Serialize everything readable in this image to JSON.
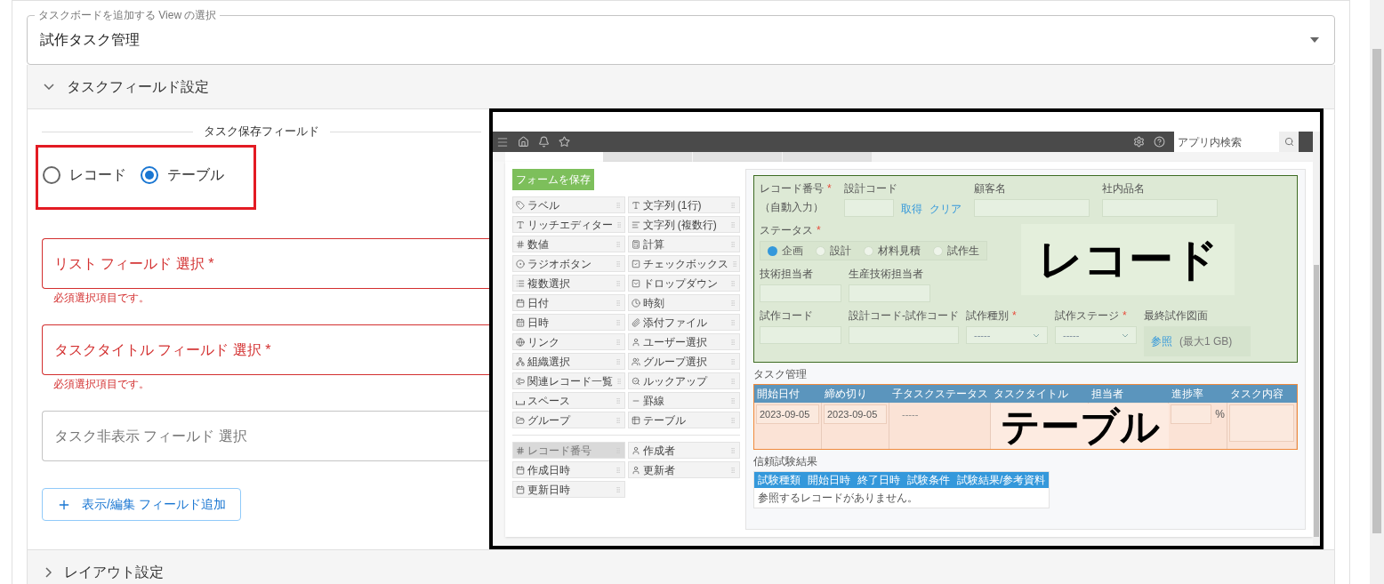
{
  "view_select": {
    "label": "タスクボードを追加する View の選択",
    "value": "試作タスク管理"
  },
  "task_field_settings": {
    "title": "タスクフィールド設定",
    "expanded": true,
    "storage": {
      "title": "タスク保存フィールド",
      "options": [
        {
          "label": "レコード",
          "selected": false
        },
        {
          "label": "テーブル",
          "selected": true
        }
      ]
    },
    "fields": [
      {
        "label": "リスト フィールド 選択 *",
        "error": true,
        "helper": "必須選択項目です。"
      },
      {
        "label": "タスクタイトル フィールド 選択 *",
        "error": true,
        "helper": "必須選択項目です。"
      },
      {
        "label": "タスク非表示 フィールド 選択",
        "error": false
      }
    ],
    "add_button": "表示/編集 フィールド追加"
  },
  "layout_settings": {
    "title": "レイアウト設定",
    "expanded": false
  },
  "screenshot": {
    "search": {
      "placeholder": "アプリ内検索"
    },
    "save_button": "フォームを保存",
    "palette": [
      "ラベル",
      "文字列 (1行)",
      "リッチエディター",
      "文字列 (複数行)",
      "数値",
      "計算",
      "ラジオボタン",
      "チェックボックス",
      "複数選択",
      "ドロップダウン",
      "日付",
      "時刻",
      "日時",
      "添付ファイル",
      "リンク",
      "ユーザー選択",
      "組織選択",
      "グループ選択",
      "関連レコード一覧",
      "ルックアップ",
      "スペース",
      "罫線",
      "グループ",
      "テーブル"
    ],
    "system_fields": [
      {
        "label": "レコード番号",
        "disabled": true
      },
      {
        "label": "作成者",
        "disabled": false
      },
      {
        "label": "作成日時",
        "disabled": false
      },
      {
        "label": "更新者",
        "disabled": false
      },
      {
        "label": "更新日時",
        "disabled": false
      }
    ],
    "record_area": {
      "label": "レコード",
      "row_1": [
        {
          "kind": "auto",
          "label": "レコード番号",
          "mark": "*",
          "note": "（自動入力）"
        },
        {
          "kind": "lookup",
          "label": "設計コード",
          "links": [
            "取得",
            "クリア"
          ]
        },
        {
          "kind": "wide",
          "label": "顧客名"
        },
        {
          "kind": "wide",
          "label": "社内品名"
        }
      ],
      "status": {
        "label": "ステータス",
        "mark": "*",
        "options": [
          {
            "label": "企画",
            "selected": true
          },
          {
            "label": "設計",
            "selected": false
          },
          {
            "label": "材料見積",
            "selected": false
          },
          {
            "label": "試作生",
            "selected": false
          }
        ]
      },
      "row_3": [
        {
          "kind": "text",
          "label": "技術担当者"
        },
        {
          "kind": "text",
          "label": "生産技術担当者"
        }
      ],
      "row_4": [
        {
          "kind": "text",
          "label": "試作コード"
        },
        {
          "kind": "text",
          "label": "設計コード-試作コード"
        },
        {
          "kind": "select",
          "label": "試作種別",
          "mark": "*",
          "placeholder": "-----"
        },
        {
          "kind": "select",
          "label": "試作ステージ",
          "mark": "*",
          "placeholder": "-----"
        },
        {
          "kind": "file",
          "label": "最終試作図面",
          "link": "参照",
          "note": "(最大1 GB)"
        }
      ]
    },
    "table_area": {
      "title": "タスク管理",
      "label": "テーブル",
      "columns": [
        "開始日付",
        "締め切り",
        "子タスクステータス",
        "タスクタイトル",
        "担当者",
        "進捗率",
        "タスク内容"
      ],
      "row": [
        {
          "kind": "text",
          "value": "2023-09-05"
        },
        {
          "kind": "text",
          "value": "2023-09-05"
        },
        {
          "kind": "select",
          "placeholder": "-----"
        },
        {
          "kind": "blank"
        },
        {
          "kind": "blank"
        },
        {
          "kind": "percent",
          "unit": "%"
        },
        {
          "kind": "textarea"
        }
      ]
    },
    "related_area": {
      "title": "信頼試験結果",
      "columns": [
        "試験種類",
        "開始日時",
        "終了日時",
        "試験条件",
        "試験結果/参考資料"
      ],
      "empty": "参照するレコードがありません。"
    }
  }
}
